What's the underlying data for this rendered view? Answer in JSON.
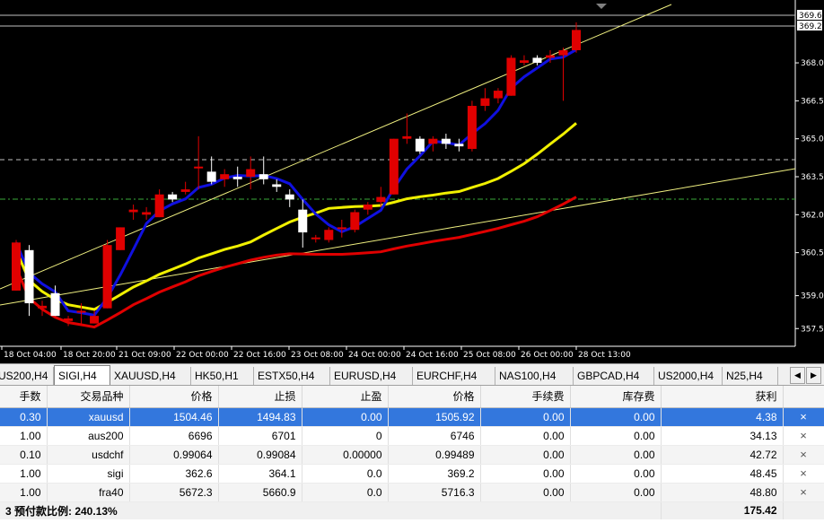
{
  "colors": {
    "background": "#000000",
    "bull_candle": "#e00000",
    "bear_candle": "#ffffff",
    "ma_fast": "#1010e0",
    "ma_mid": "#f0f000",
    "ma_slow": "#e00000",
    "trendline": "#f0f080",
    "level_line": "#c0c0c0",
    "selection": "#3377dd"
  },
  "chart_data": {
    "type": "candlestick",
    "symbol_timeframe": "SIGI,H4",
    "price_axis": {
      "ticks": [
        357.5,
        358.8,
        360.5,
        362.0,
        363.5,
        365.0,
        366.5,
        368.0
      ],
      "tick_labels": [
        "357.5",
        "359.0",
        "360.5",
        "362.0",
        "363.5",
        "365.0",
        "366.5",
        "368.0"
      ],
      "top_labels": [
        "369.6",
        "369.2"
      ],
      "ylim": [
        356.8,
        370.2
      ]
    },
    "time_labels": [
      "18 Oct 04:00",
      "18 Oct 20:00",
      "21 Oct 09:00",
      "22 Oct 00:00",
      "22 Oct 16:00",
      "23 Oct 08:00",
      "24 Oct 00:00",
      "24 Oct 16:00",
      "25 Oct 08:00",
      "26 Oct 00:00",
      "28 Oct 13:00"
    ],
    "candles": [
      {
        "o": 359.0,
        "h": 361.0,
        "l": 359.0,
        "c": 360.9
      },
      {
        "o": 360.6,
        "h": 360.8,
        "l": 358.0,
        "c": 358.5
      },
      {
        "o": 358.3,
        "h": 358.6,
        "l": 358.0,
        "c": 358.4
      },
      {
        "o": 358.9,
        "h": 359.2,
        "l": 358.0,
        "c": 358.0
      },
      {
        "o": 357.8,
        "h": 358.0,
        "l": 357.6,
        "c": 357.9
      },
      {
        "o": 358.2,
        "h": 358.5,
        "l": 357.7,
        "c": 358.2
      },
      {
        "o": 357.7,
        "h": 358.2,
        "l": 357.7,
        "c": 358.0
      },
      {
        "o": 358.3,
        "h": 361.0,
        "l": 358.3,
        "c": 360.8
      },
      {
        "o": 360.6,
        "h": 361.5,
        "l": 360.6,
        "c": 361.5
      },
      {
        "o": 362.1,
        "h": 362.4,
        "l": 361.8,
        "c": 362.2
      },
      {
        "o": 362.0,
        "h": 362.3,
        "l": 361.8,
        "c": 362.1
      },
      {
        "o": 361.9,
        "h": 363.0,
        "l": 361.9,
        "c": 362.8
      },
      {
        "o": 362.8,
        "h": 362.9,
        "l": 362.5,
        "c": 362.6
      },
      {
        "o": 362.9,
        "h": 363.3,
        "l": 362.8,
        "c": 363.0
      },
      {
        "o": 363.9,
        "h": 365.1,
        "l": 363.0,
        "c": 363.9
      },
      {
        "o": 363.7,
        "h": 364.3,
        "l": 363.2,
        "c": 363.3
      },
      {
        "o": 363.4,
        "h": 363.8,
        "l": 363.1,
        "c": 363.6
      },
      {
        "o": 363.5,
        "h": 363.9,
        "l": 363.1,
        "c": 363.4
      },
      {
        "o": 363.5,
        "h": 364.3,
        "l": 363.0,
        "c": 363.8
      },
      {
        "o": 363.6,
        "h": 364.3,
        "l": 363.2,
        "c": 363.4
      },
      {
        "o": 363.2,
        "h": 363.4,
        "l": 362.9,
        "c": 363.1
      },
      {
        "o": 362.8,
        "h": 363.0,
        "l": 362.3,
        "c": 362.6
      },
      {
        "o": 362.2,
        "h": 362.6,
        "l": 360.7,
        "c": 361.3
      },
      {
        "o": 361.1,
        "h": 361.2,
        "l": 360.9,
        "c": 361.1
      },
      {
        "o": 361.0,
        "h": 361.5,
        "l": 360.9,
        "c": 361.4
      },
      {
        "o": 361.5,
        "h": 361.8,
        "l": 361.1,
        "c": 361.5
      },
      {
        "o": 361.4,
        "h": 362.2,
        "l": 361.3,
        "c": 362.1
      },
      {
        "o": 362.2,
        "h": 362.5,
        "l": 362.0,
        "c": 362.4
      },
      {
        "o": 362.5,
        "h": 363.1,
        "l": 362.3,
        "c": 362.7
      },
      {
        "o": 362.8,
        "h": 365.0,
        "l": 362.8,
        "c": 365.0
      },
      {
        "o": 365.0,
        "h": 366.0,
        "l": 364.8,
        "c": 365.1
      },
      {
        "o": 365.0,
        "h": 365.1,
        "l": 364.4,
        "c": 364.5
      },
      {
        "o": 364.8,
        "h": 365.1,
        "l": 364.5,
        "c": 365.0
      },
      {
        "o": 365.0,
        "h": 365.2,
        "l": 364.6,
        "c": 364.8
      },
      {
        "o": 364.8,
        "h": 365.0,
        "l": 364.5,
        "c": 364.7
      },
      {
        "o": 364.6,
        "h": 366.5,
        "l": 364.5,
        "c": 366.3
      },
      {
        "o": 366.3,
        "h": 367.0,
        "l": 366.1,
        "c": 366.6
      },
      {
        "o": 366.6,
        "h": 367.0,
        "l": 366.4,
        "c": 366.9
      },
      {
        "o": 366.7,
        "h": 368.3,
        "l": 366.7,
        "c": 368.2
      },
      {
        "o": 368.0,
        "h": 368.3,
        "l": 367.9,
        "c": 368.1
      },
      {
        "o": 368.2,
        "h": 368.3,
        "l": 367.9,
        "c": 368.0
      },
      {
        "o": 368.2,
        "h": 368.5,
        "l": 368.0,
        "c": 368.3
      },
      {
        "o": 368.3,
        "h": 368.6,
        "l": 366.5,
        "c": 368.5
      },
      {
        "o": 368.5,
        "h": 369.6,
        "l": 368.4,
        "c": 369.3
      }
    ]
  },
  "tabs": [
    {
      "label": "US200,H4",
      "active": false
    },
    {
      "label": "SIGI,H4",
      "active": true
    },
    {
      "label": "XAUUSD,H4",
      "active": false
    },
    {
      "label": "HK50,H1",
      "active": false
    },
    {
      "label": "ESTX50,H4",
      "active": false
    },
    {
      "label": "EURUSD,H4",
      "active": false
    },
    {
      "label": "EURCHF,H4",
      "active": false
    },
    {
      "label": "NAS100,H4",
      "active": false
    },
    {
      "label": "GBPCAD,H4",
      "active": false
    },
    {
      "label": "US2000,H4",
      "active": false
    },
    {
      "label": "N25,H4",
      "active": false
    }
  ],
  "tab_arrows": {
    "left": "◀",
    "right": "▶"
  },
  "table": {
    "headers": [
      "手数",
      "交易品种",
      "价格",
      "止损",
      "止盈",
      "价格",
      "手续费",
      "库存费",
      "获利"
    ],
    "rows": [
      [
        "0.30",
        "xauusd",
        "1504.46",
        "1494.83",
        "0.00",
        "1505.92",
        "0.00",
        "0.00",
        "4.38"
      ],
      [
        "1.00",
        "aus200",
        "6696",
        "6701",
        "0",
        "6746",
        "0.00",
        "0.00",
        "34.13"
      ],
      [
        "0.10",
        "usdchf",
        "0.99064",
        "0.99084",
        "0.00000",
        "0.99489",
        "0.00",
        "0.00",
        "42.72"
      ],
      [
        "1.00",
        "sigi",
        "362.6",
        "364.1",
        "0.0",
        "369.2",
        "0.00",
        "0.00",
        "48.45"
      ],
      [
        "1.00",
        "fra40",
        "5672.3",
        "5660.9",
        "0.0",
        "5716.3",
        "0.00",
        "0.00",
        "48.80"
      ]
    ],
    "close_glyph": "×",
    "summary": {
      "left_prefix": "3",
      "margin_level": "预付款比例: 240.13%",
      "total": "175.42"
    }
  }
}
